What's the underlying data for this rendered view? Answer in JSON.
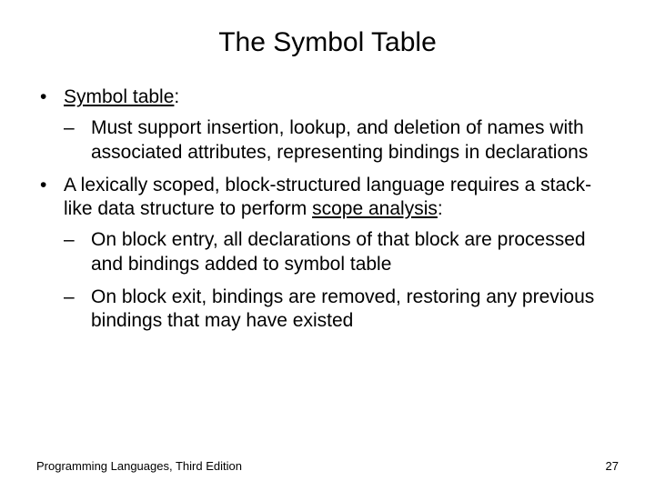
{
  "title": "The Symbol Table",
  "bullets": [
    {
      "text_html": "<span class='underline'>Symbol table</span>:",
      "subs": [
        "Must support insertion, lookup, and deletion of names with associated attributes, representing bindings in declarations"
      ]
    },
    {
      "text_html": "A lexically scoped, block-structured language requires a stack-like data structure to perform <span class='underline'>scope analysis</span>:",
      "subs": [
        "On block entry, all declarations of that block are processed and bindings added to symbol table",
        "On block exit, bindings are removed, restoring any previous bindings that may have existed"
      ]
    }
  ],
  "footer": {
    "left": "Programming Languages, Third Edition",
    "right": "27"
  }
}
